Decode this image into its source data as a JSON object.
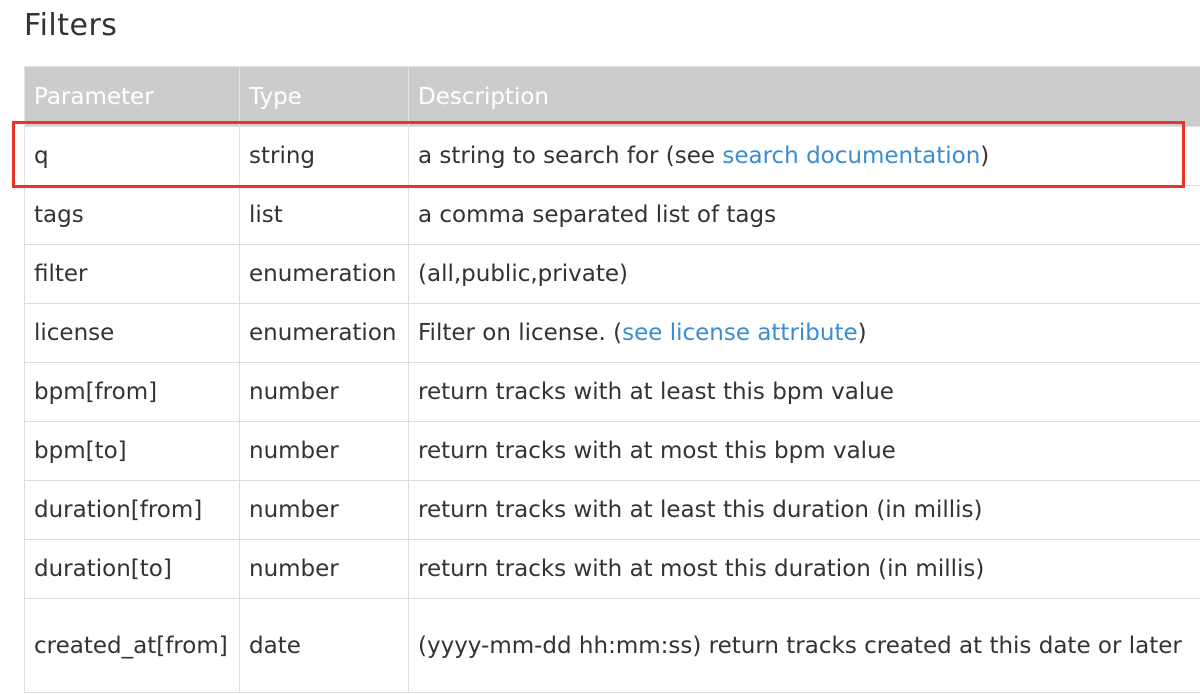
{
  "title": "Filters",
  "columns": [
    "Parameter",
    "Type",
    "Description"
  ],
  "rows": [
    {
      "param": "q",
      "type": "string",
      "desc_pre": "a string to search for (see ",
      "link": "search documentation",
      "desc_post": ")"
    },
    {
      "param": "tags",
      "type": "list",
      "desc": "a comma separated list of tags"
    },
    {
      "param": "filter",
      "type": "enumeration",
      "desc": "(all,public,private)"
    },
    {
      "param": "license",
      "type": "enumeration",
      "desc_pre": "Filter on license. (",
      "link": "see license attribute",
      "desc_post": ")"
    },
    {
      "param": "bpm[from]",
      "type": "number",
      "desc": "return tracks with at least this bpm value"
    },
    {
      "param": "bpm[to]",
      "type": "number",
      "desc": "return tracks with at most this bpm value"
    },
    {
      "param": "duration[from]",
      "type": "number",
      "desc": "return tracks with at least this duration (in millis)"
    },
    {
      "param": "duration[to]",
      "type": "number",
      "desc": "return tracks with at most this duration (in millis)"
    },
    {
      "param": "created_at[from]",
      "type": "date",
      "desc": "(yyyy-mm-dd hh:mm:ss) return tracks created at this date or later"
    }
  ],
  "colors": {
    "header_bg": "#cccccc",
    "link": "#3a8cd3",
    "highlight": "#e8342a"
  }
}
